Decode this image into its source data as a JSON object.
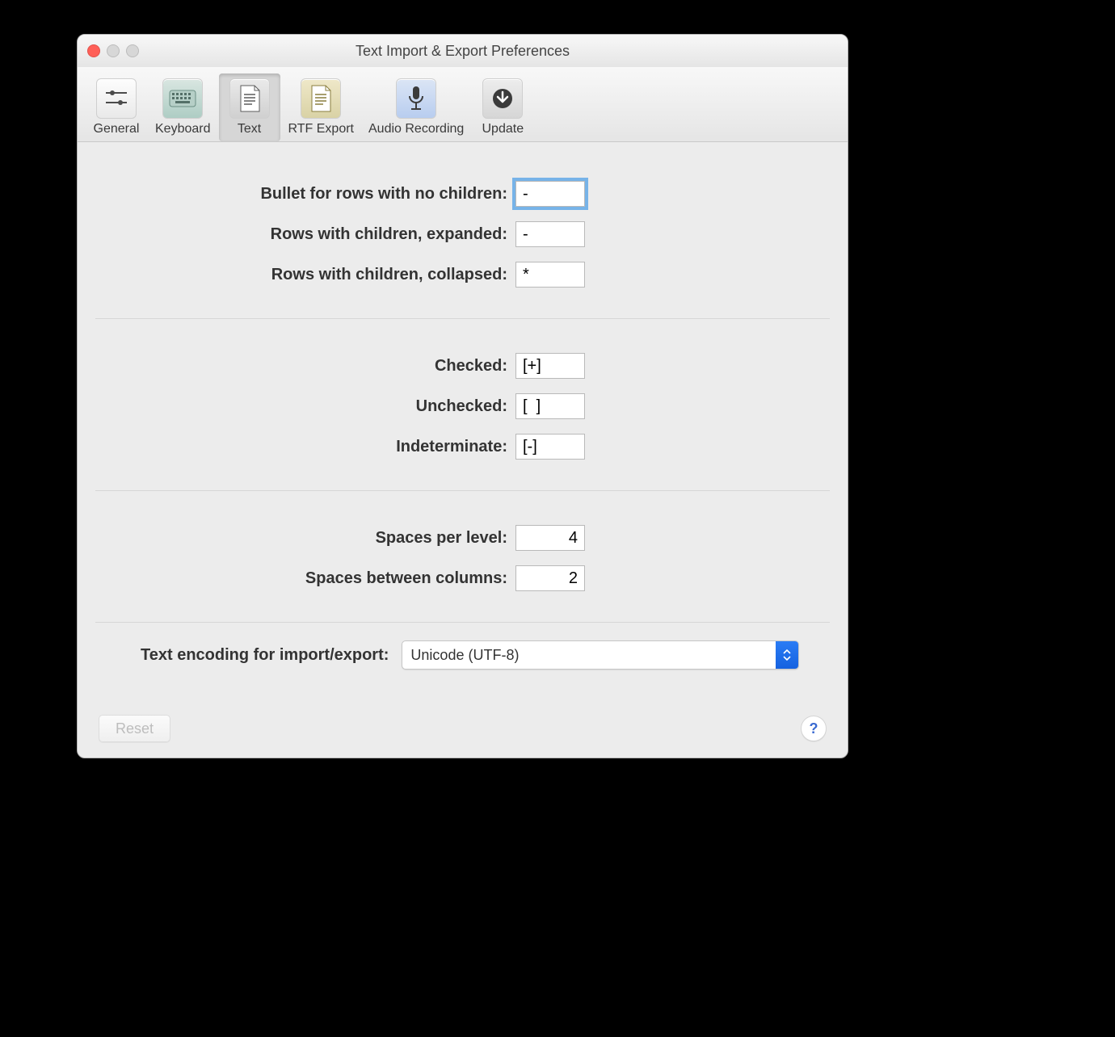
{
  "window": {
    "title": "Text Import & Export Preferences"
  },
  "toolbar": {
    "items": [
      {
        "id": "general",
        "label": "General"
      },
      {
        "id": "keyboard",
        "label": "Keyboard"
      },
      {
        "id": "text",
        "label": "Text"
      },
      {
        "id": "rtf",
        "label": "RTF Export"
      },
      {
        "id": "audio",
        "label": "Audio Recording"
      },
      {
        "id": "update",
        "label": "Update"
      }
    ],
    "selected": "text"
  },
  "fields": {
    "bullet_no_children": {
      "label": "Bullet for rows with no children:",
      "value": "-"
    },
    "bullet_expanded": {
      "label": "Rows with children, expanded:",
      "value": "-"
    },
    "bullet_collapsed": {
      "label": "Rows with children, collapsed:",
      "value": "*"
    },
    "checked": {
      "label": "Checked:",
      "value": "[+]"
    },
    "unchecked": {
      "label": "Unchecked:",
      "value": "[  ]"
    },
    "indeterminate": {
      "label": "Indeterminate:",
      "value": "[-]"
    },
    "spaces_per_level": {
      "label": "Spaces per level:",
      "value": "4"
    },
    "spaces_between_cols": {
      "label": "Spaces between columns:",
      "value": "2"
    }
  },
  "encoding": {
    "label": "Text encoding for import/export:",
    "value": "Unicode (UTF-8)"
  },
  "footer": {
    "reset_label": "Reset",
    "help_label": "?"
  }
}
